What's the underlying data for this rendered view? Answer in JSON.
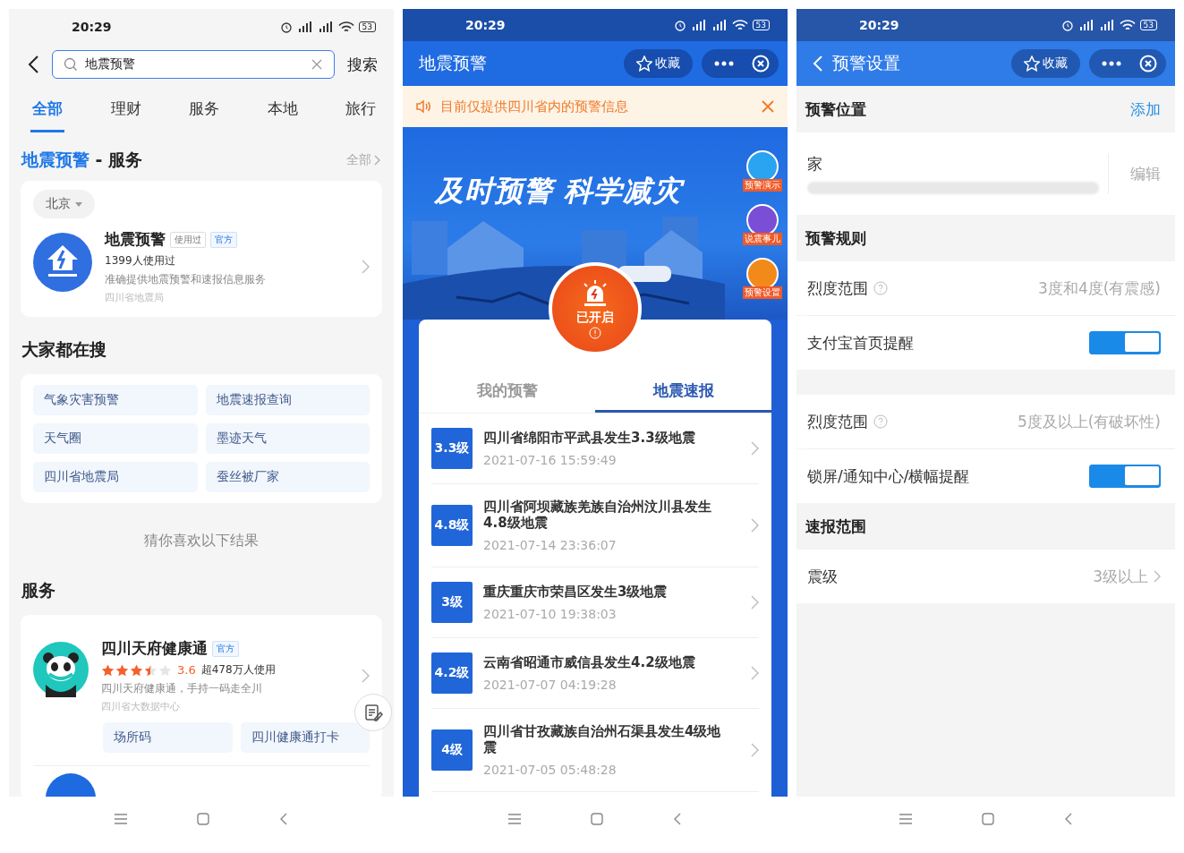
{
  "left": {
    "status": {
      "time": "20:29",
      "battery": "53"
    },
    "search": {
      "value": "地震预警",
      "button": "搜索"
    },
    "tabs": [
      {
        "label": "全部",
        "selected": true
      },
      {
        "label": "理财",
        "selected": false
      },
      {
        "label": "服务",
        "selected": false
      },
      {
        "label": "本地",
        "selected": false
      },
      {
        "label": "旅行",
        "selected": false
      }
    ],
    "section": {
      "keyword": "地震预警",
      "rest": "- 服务",
      "more": "全部"
    },
    "result": {
      "city": "北京",
      "title": "地震预警",
      "badges": [
        {
          "label": "使用过",
          "kind": "plain"
        },
        {
          "label": "官方",
          "kind": "official"
        }
      ],
      "users": "1399人使用过",
      "desc": "准确提供地震预警和速报信息服务",
      "org": "四川省地震局"
    },
    "popular": {
      "title": "大家都在搜",
      "items": [
        "气象灾害预警",
        "地震速报查询",
        "天气圈",
        "墨迹天气",
        "四川省地震局",
        "蚕丝被厂家"
      ]
    },
    "suggest": "猜你喜欢以下结果",
    "services": {
      "title": "服务",
      "item": {
        "title": "四川天府健康通",
        "badge": "官方",
        "stars": 3.5,
        "rating": "3.6",
        "users": "超478万人使用",
        "desc": "四川天府健康通，手持一码走全川",
        "org": "四川省大数据中心",
        "actions": [
          "场所码",
          "四川健康通打卡"
        ]
      }
    }
  },
  "middle": {
    "status": {
      "time": "20:29",
      "battery": "53"
    },
    "title": "地震预警",
    "favorite": "收藏",
    "notice": "目前仅提供四川省内的预警信息",
    "slogan": "及时预警 科学减灾",
    "side_buttons": [
      {
        "label": "预警演示",
        "color": "#2aa3f0"
      },
      {
        "label": "说震事儿",
        "color": "#7a4fd6"
      },
      {
        "label": "预警设置",
        "color": "#f28a1a"
      }
    ],
    "alarm": "已开启",
    "tabs": [
      {
        "label": "我的预警",
        "selected": false
      },
      {
        "label": "地震速报",
        "selected": true
      }
    ],
    "quakes": [
      {
        "magnitude": "3.3级",
        "title": "四川省绵阳市平武县发生3.3级地震",
        "time": "2021-07-16 15:59:49"
      },
      {
        "magnitude": "4.8级",
        "title": "四川省阿坝藏族羌族自治州汶川县发生4.8级地震",
        "time": "2021-07-14 23:36:07"
      },
      {
        "magnitude": "3级",
        "title": "重庆重庆市荣昌区发生3级地震",
        "time": "2021-07-10 19:38:03"
      },
      {
        "magnitude": "4.2级",
        "title": "云南省昭通市威信县发生4.2级地震",
        "time": "2021-07-07 04:19:28"
      },
      {
        "magnitude": "4级",
        "title": "四川省甘孜藏族自治州石渠县发生4级地震",
        "time": "2021-07-05 05:48:28"
      }
    ]
  },
  "right": {
    "status": {
      "time": "20:29",
      "battery": "53"
    },
    "title": "预警设置",
    "favorite": "收藏",
    "sections": [
      {
        "heading": "预警位置",
        "action": "添加",
        "rows": [
          {
            "kind": "location",
            "label": "家",
            "action": "编辑"
          }
        ]
      },
      {
        "heading": "预警规则",
        "rows": [
          {
            "kind": "value",
            "label": "烈度范围",
            "help": true,
            "value": "3度和4度(有震感)"
          },
          {
            "kind": "toggle",
            "label": "支付宝首页提醒",
            "on": true
          }
        ]
      },
      {
        "rows": [
          {
            "kind": "value",
            "label": "烈度范围",
            "help": true,
            "value": "5度及以上(有破坏性)"
          },
          {
            "kind": "toggle",
            "label": "锁屏/通知中心/横幅提醒",
            "on": true
          }
        ]
      },
      {
        "heading": "速报范围",
        "rows": [
          {
            "kind": "link",
            "label": "震级",
            "value": "3级以上"
          }
        ]
      }
    ]
  }
}
